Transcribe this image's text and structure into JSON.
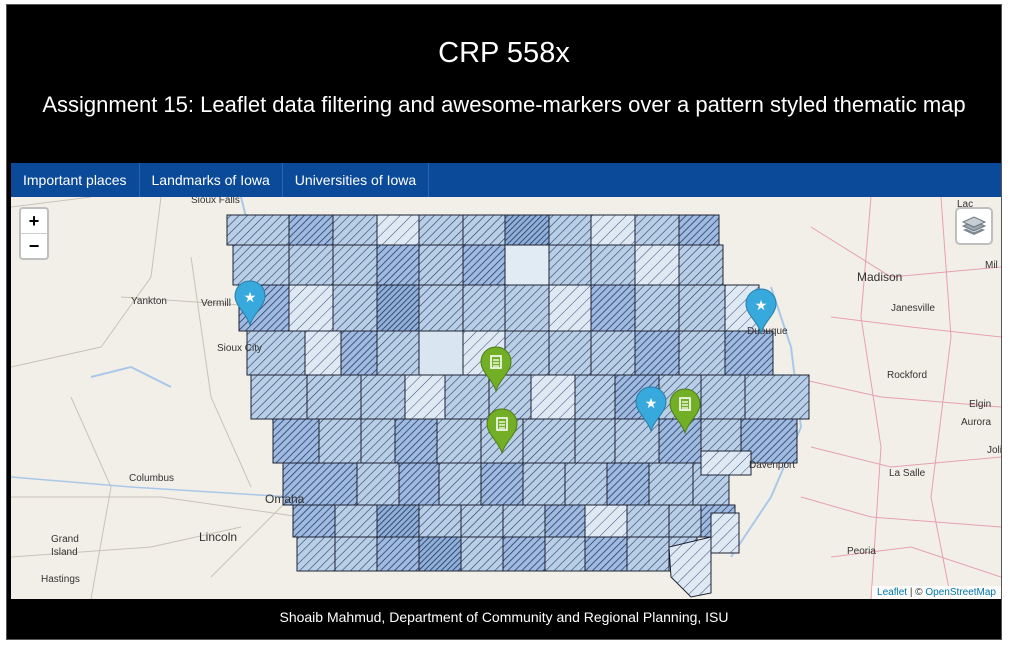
{
  "header": {
    "title": "CRP 558x",
    "subtitle": "Assignment 15: Leaflet data filtering and awesome-markers over a pattern styled thematic map"
  },
  "nav": {
    "items": [
      {
        "label": "Important places"
      },
      {
        "label": "Landmarks of Iowa"
      },
      {
        "label": "Universities of Iowa"
      }
    ]
  },
  "map": {
    "zoom_in": "+",
    "zoom_out": "−",
    "layers_icon": "layers-icon",
    "attribution": {
      "leaflet": "Leaflet",
      "sep": " | © ",
      "osm": "OpenStreetMap"
    },
    "labels": [
      "Sioux Falls",
      "Yankton",
      "Vermill",
      "Sioux City",
      "Omaha",
      "Columbus",
      "Lincoln",
      "Grand Island",
      "Hastings",
      "Madison",
      "Janesville",
      "Rockford",
      "Elgin",
      "Aurora",
      "La Salle",
      "Peoria",
      "Davenport",
      "Dubuque",
      "Mil",
      "Lac",
      "Joli"
    ],
    "markers": [
      {
        "type": "star",
        "color": "#38a9dc"
      },
      {
        "type": "star",
        "color": "#38a9dc"
      },
      {
        "type": "star",
        "color": "#38a9dc"
      },
      {
        "type": "list",
        "color": "#72af26"
      },
      {
        "type": "list",
        "color": "#72af26"
      },
      {
        "type": "list",
        "color": "#72af26"
      }
    ],
    "colors": {
      "fill_light": "#dfe9f3",
      "fill_mid": "#b8cfe6",
      "fill_dark": "#8fb0d8",
      "hatch": "#2b3a67"
    }
  },
  "footer": {
    "text": "Shoaib Mahmud, Department of Community and Regional Planning, ISU"
  }
}
